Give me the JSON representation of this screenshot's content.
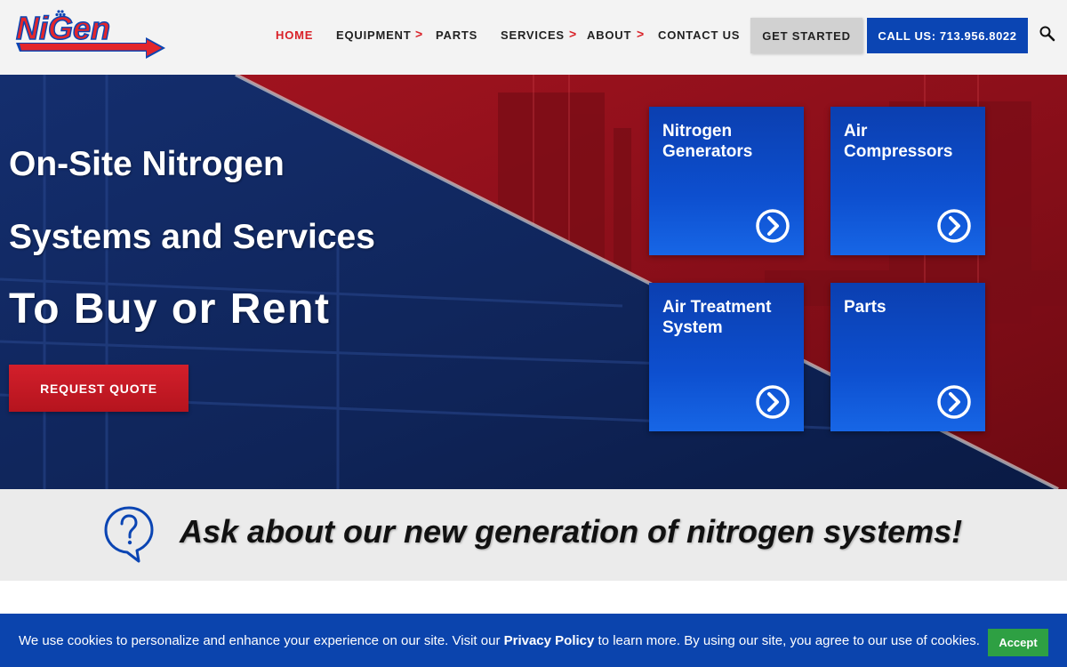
{
  "brand": {
    "logo_text": "NiGen",
    "colors": {
      "red": "#d92128",
      "blue": "#0b45b3"
    }
  },
  "nav": {
    "home": "HOME",
    "equipment": "EQUIPMENT",
    "parts": "PARTS",
    "services": "SERVICES",
    "about": "ABOUT",
    "contact": "CONTACT US",
    "arrow": ">",
    "get_started": "GET STARTED",
    "call": "CALL US: 713.956.8022",
    "search_icon": "search-icon"
  },
  "hero": {
    "line1": "On-Site Nitrogen",
    "line2": "Systems and Services",
    "line3": "To Buy or Rent",
    "cta": "REQUEST QUOTE",
    "tiles": [
      {
        "label": "Nitrogen Generators",
        "icon": "chevron-right-circle-icon"
      },
      {
        "label": "Air Compressors",
        "icon": "chevron-right-circle-icon"
      },
      {
        "label": "Air Treatment System",
        "icon": "chevron-right-circle-icon"
      },
      {
        "label": "Parts",
        "icon": "chevron-right-circle-icon"
      }
    ]
  },
  "ask": {
    "text": "Ask about our new generation of nitrogen systems!",
    "icon": "question-bubble-icon"
  },
  "cookie": {
    "text_before": "We use cookies to personalize and enhance your experience on our site. Visit our ",
    "link": "Privacy Policy",
    "text_after": " to learn more. By using our site, you agree to our use of cookies.",
    "accept": "Accept"
  }
}
